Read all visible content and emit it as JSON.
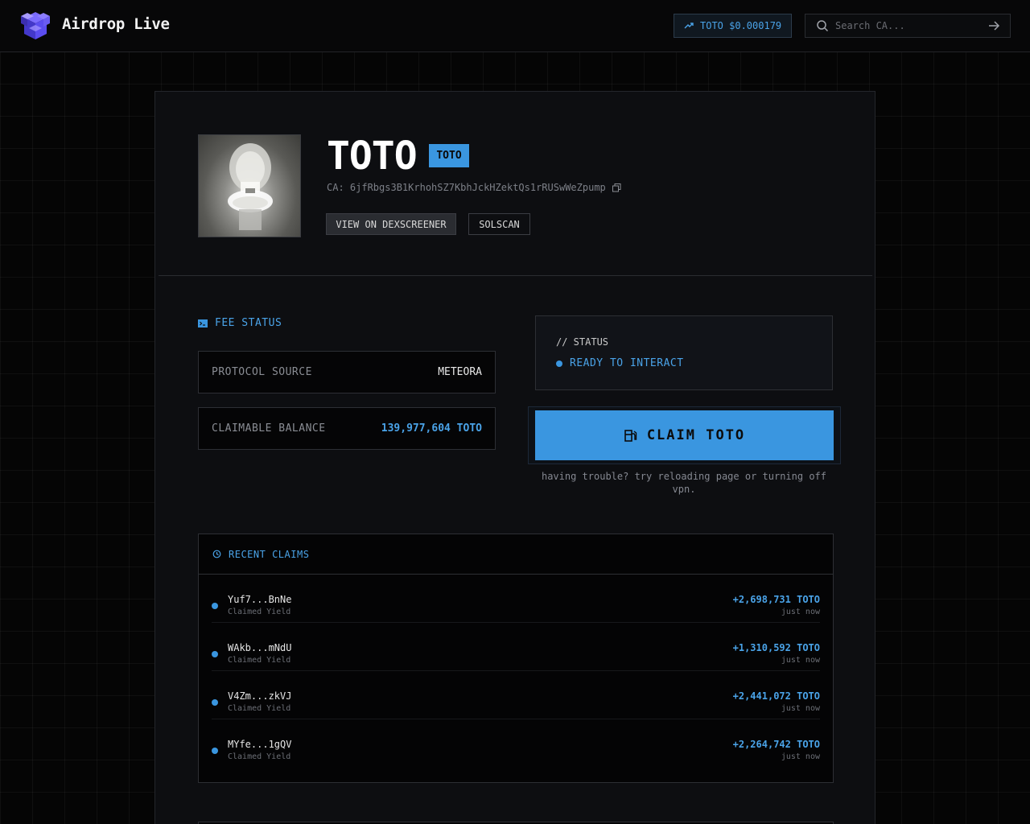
{
  "header": {
    "brand": "Airdrop Live",
    "price_chip": "TOTO $0.000179",
    "search_placeholder": "Search CA..."
  },
  "token": {
    "name": "TOTO",
    "ticker": "TOTO",
    "ca": "CA: 6jfRbgs3B1KrhohSZ7KbhJckHZektQs1rRUSwWeZpump",
    "btn_dex": "VIEW ON DEXSCREENER",
    "btn_solscan": "SOLSCAN"
  },
  "fee_status": {
    "title": "FEE STATUS",
    "protocol_label": "PROTOCOL SOURCE",
    "protocol_value": "METEORA",
    "balance_label": "CLAIMABLE BALANCE",
    "balance_value": "139,977,604 TOTO"
  },
  "status": {
    "label": "// STATUS",
    "value": "READY TO INTERACT"
  },
  "claim": {
    "button": "CLAIM TOTO",
    "trouble": "having trouble? try reloading page or turning off vpn."
  },
  "recent_claims": {
    "title": "RECENT CLAIMS",
    "items": [
      {
        "address": "Yuf7...BnNe",
        "sub": "Claimed Yield",
        "amount": "+2,698,731 TOTO",
        "time": "just now"
      },
      {
        "address": "WAkb...mNdU",
        "sub": "Claimed Yield",
        "amount": "+1,310,592 TOTO",
        "time": "just now"
      },
      {
        "address": "V4Zm...zkVJ",
        "sub": "Claimed Yield",
        "amount": "+2,441,072 TOTO",
        "time": "just now"
      },
      {
        "address": "MYfe...1gQV",
        "sub": "Claimed Yield",
        "amount": "+2,264,742 TOTO",
        "time": "just now"
      }
    ]
  },
  "colors": {
    "accent": "#3a96e0",
    "background": "#050505",
    "card": "#0d0e11"
  },
  "icons": [
    "cube-logo-icon",
    "trending-up-icon",
    "search-icon",
    "arrow-right-icon",
    "copy-icon",
    "terminal-icon",
    "fuel-icon",
    "history-icon"
  ]
}
